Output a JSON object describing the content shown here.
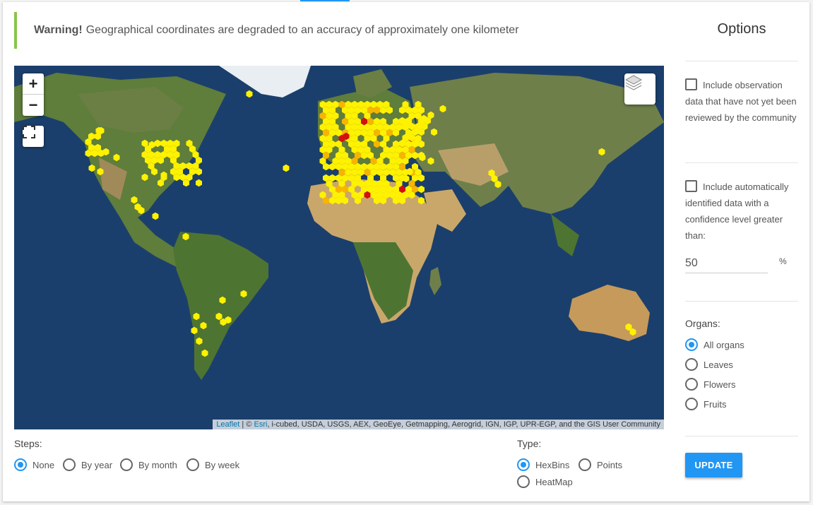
{
  "warning": {
    "label": "Warning!",
    "text": "Geographical coordinates are degraded to an accuracy of approximately one kilometer"
  },
  "map": {
    "zoom_in": "+",
    "zoom_out": "−",
    "attribution_link": "Leaflet",
    "attribution_sep": " | © ",
    "attribution_esri": "Esri",
    "attribution_rest": ", i-cubed, USDA, USGS, AEX, GeoEye, Getmapping, Aerogrid, IGN, IGP, UPR-EGP, and the GIS User Community",
    "icons": [
      "plus-icon",
      "minus-icon",
      "fullscreen-icon",
      "layers-icon"
    ],
    "colors": {
      "ocean": "#1b3f6c",
      "land": "#5f7d3b",
      "desert": "#c9a76a",
      "ice": "#e8eef2",
      "bin_low": "#fff200",
      "bin_mid": "#f7b500",
      "bin_high": "#d40f0f"
    }
  },
  "steps": {
    "label": "Steps:",
    "options": [
      "None",
      "By year",
      "By month",
      "By week"
    ],
    "selected": "None"
  },
  "type": {
    "label": "Type:",
    "options": [
      "HexBins",
      "Points",
      "HeatMap"
    ],
    "selected": "HexBins"
  },
  "options": {
    "title": "Options",
    "unreviewed_label": "Include observation data that have not yet been reviewed by the community",
    "auto_label": "Include automatically identified data with a confidence level greater than:",
    "confidence_value": "50",
    "percent": "%",
    "organs_label": "Organs:",
    "organs": [
      "All organs",
      "Leaves",
      "Flowers",
      "Fruits"
    ],
    "organs_selected": "All organs",
    "update": "UPDATE"
  },
  "accent": "#2196f3"
}
